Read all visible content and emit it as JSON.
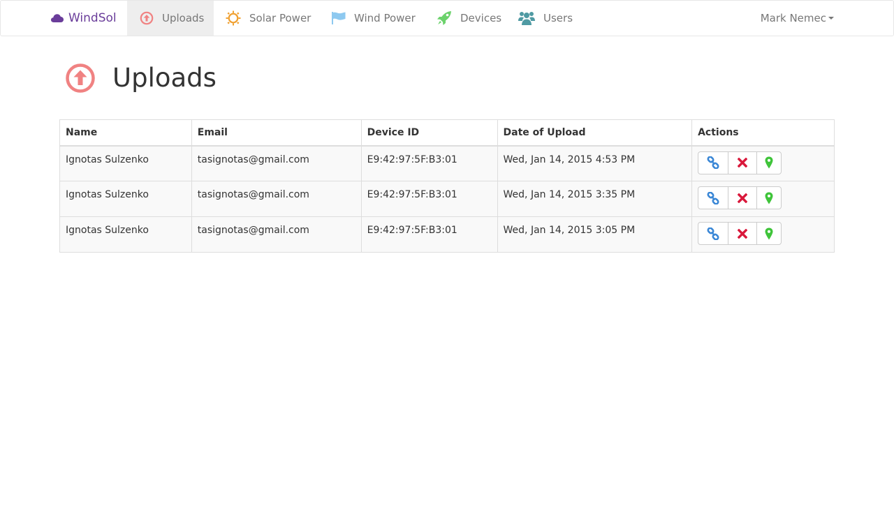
{
  "navbar": {
    "brand": "WindSol",
    "items": [
      {
        "label": "Uploads",
        "icon": "upload-circle-icon",
        "active": true
      },
      {
        "label": "Solar Power",
        "icon": "sun-icon"
      },
      {
        "label": "Wind Power",
        "icon": "flag-icon"
      },
      {
        "label": "Devices",
        "icon": "rocket-icon"
      },
      {
        "label": "Users",
        "icon": "users-icon"
      }
    ],
    "user": "Mark Nemec"
  },
  "page": {
    "title": "Uploads"
  },
  "table": {
    "columns": [
      "Name",
      "Email",
      "Device ID",
      "Date of Upload",
      "Actions"
    ],
    "rows": [
      {
        "name": "Ignotas Sulzenko",
        "email": "tasignotas@gmail.com",
        "device_id": "E9:42:97:5F:B3:01",
        "date": "Wed, Jan 14, 2015 4:53 PM"
      },
      {
        "name": "Ignotas Sulzenko",
        "email": "tasignotas@gmail.com",
        "device_id": "E9:42:97:5F:B3:01",
        "date": "Wed, Jan 14, 2015 3:35 PM"
      },
      {
        "name": "Ignotas Sulzenko",
        "email": "tasignotas@gmail.com",
        "device_id": "E9:42:97:5F:B3:01",
        "date": "Wed, Jan 14, 2015 3:05 PM"
      }
    ],
    "actions": [
      {
        "icon": "link-icon",
        "color": "#3a87d6"
      },
      {
        "icon": "close-icon",
        "color": "#d9183b"
      },
      {
        "icon": "map-marker-icon",
        "color": "#3fc43a"
      }
    ]
  },
  "colors": {
    "brand": "#6a3d9a",
    "uploads_icon": "#f08282",
    "solar_icon": "#f0a030",
    "wind_icon": "#8ec9f0",
    "devices_icon": "#6cd26c",
    "users_icon": "#4f9aa3"
  }
}
